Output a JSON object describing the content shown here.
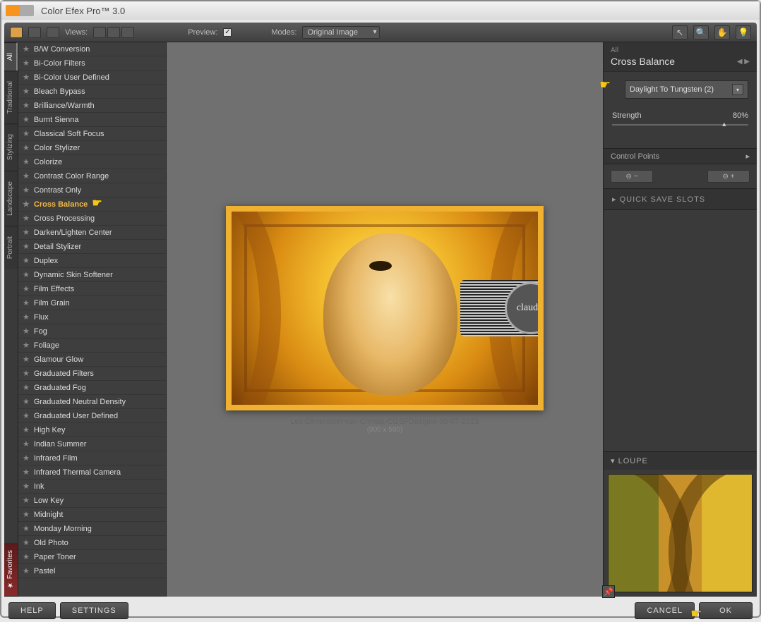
{
  "title": "Color Efex Pro™ 3.0",
  "toolbar": {
    "views_label": "Views:",
    "preview_label": "Preview:",
    "modes_label": "Modes:",
    "modes_value": "Original Image"
  },
  "side_tabs": [
    "All",
    "Traditional",
    "Stylizing",
    "Landscape",
    "Portrait"
  ],
  "favorites_label": "★ Favorites",
  "filters": [
    "B/W Conversion",
    "Bi-Color Filters",
    "Bi-Color User Defined",
    "Bleach Bypass",
    "Brilliance/Warmth",
    "Burnt Sienna",
    "Classical Soft Focus",
    "Color Stylizer",
    "Colorize",
    "Contrast Color Range",
    "Contrast Only",
    "Cross Balance",
    "Cross Processing",
    "Darken/Lighten Center",
    "Detail Stylizer",
    "Duplex",
    "Dynamic Skin Softener",
    "Film Effects",
    "Film Grain",
    "Flux",
    "Fog",
    "Foliage",
    "Glamour Glow",
    "Graduated Filters",
    "Graduated Fog",
    "Graduated Neutral Density",
    "Graduated User Defined",
    "High Key",
    "Indian Summer",
    "Infrared Film",
    "Infrared Thermal Camera",
    "Ink",
    "Low Key",
    "Midnight",
    "Monday Morning",
    "Old Photo",
    "Paper Toner",
    "Pastel"
  ],
  "active_filter_index": 11,
  "caption": {
    "filename": "Les-Dimension-van-Christa-CGSFDesigns-30-07-2023",
    "size": "(900 x 580)"
  },
  "watermark_text": "claudia",
  "right": {
    "category": "All",
    "filter_name": "Cross Balance",
    "dropdown": "Daylight To Tungsten (2)",
    "strength_label": "Strength",
    "strength_value": "80%",
    "control_points_label": "Control Points",
    "quick_save_label": "QUICK SAVE SLOTS",
    "loupe_label": "LOUPE"
  },
  "footer": {
    "help": "HELP",
    "settings": "SETTINGS",
    "cancel": "CANCEL",
    "ok": "OK"
  }
}
